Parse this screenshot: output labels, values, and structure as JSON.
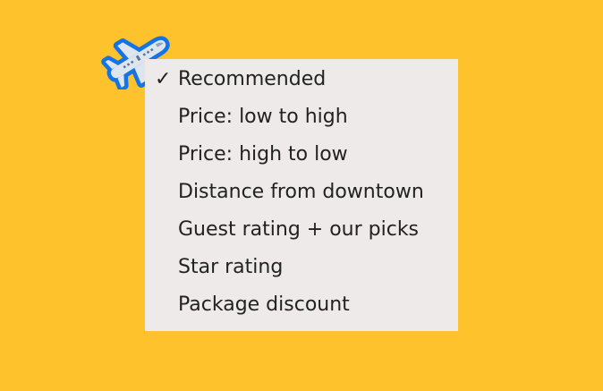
{
  "colors": {
    "background": "#FEC22D",
    "menu_background": "#EEEAEA",
    "menu_text": "#222222",
    "icon_outline": "#1473E6",
    "icon_body": "#DDE5EE"
  },
  "logo": {
    "icon": "airplane-icon"
  },
  "sort_menu": {
    "selected_index": 0,
    "check_glyph": "✓",
    "options": [
      {
        "label": "Recommended",
        "selected": true
      },
      {
        "label": "Price: low to high",
        "selected": false
      },
      {
        "label": "Price: high to low",
        "selected": false
      },
      {
        "label": "Distance from downtown",
        "selected": false
      },
      {
        "label": "Guest rating + our picks",
        "selected": false
      },
      {
        "label": "Star rating",
        "selected": false
      },
      {
        "label": "Package discount",
        "selected": false
      }
    ]
  }
}
